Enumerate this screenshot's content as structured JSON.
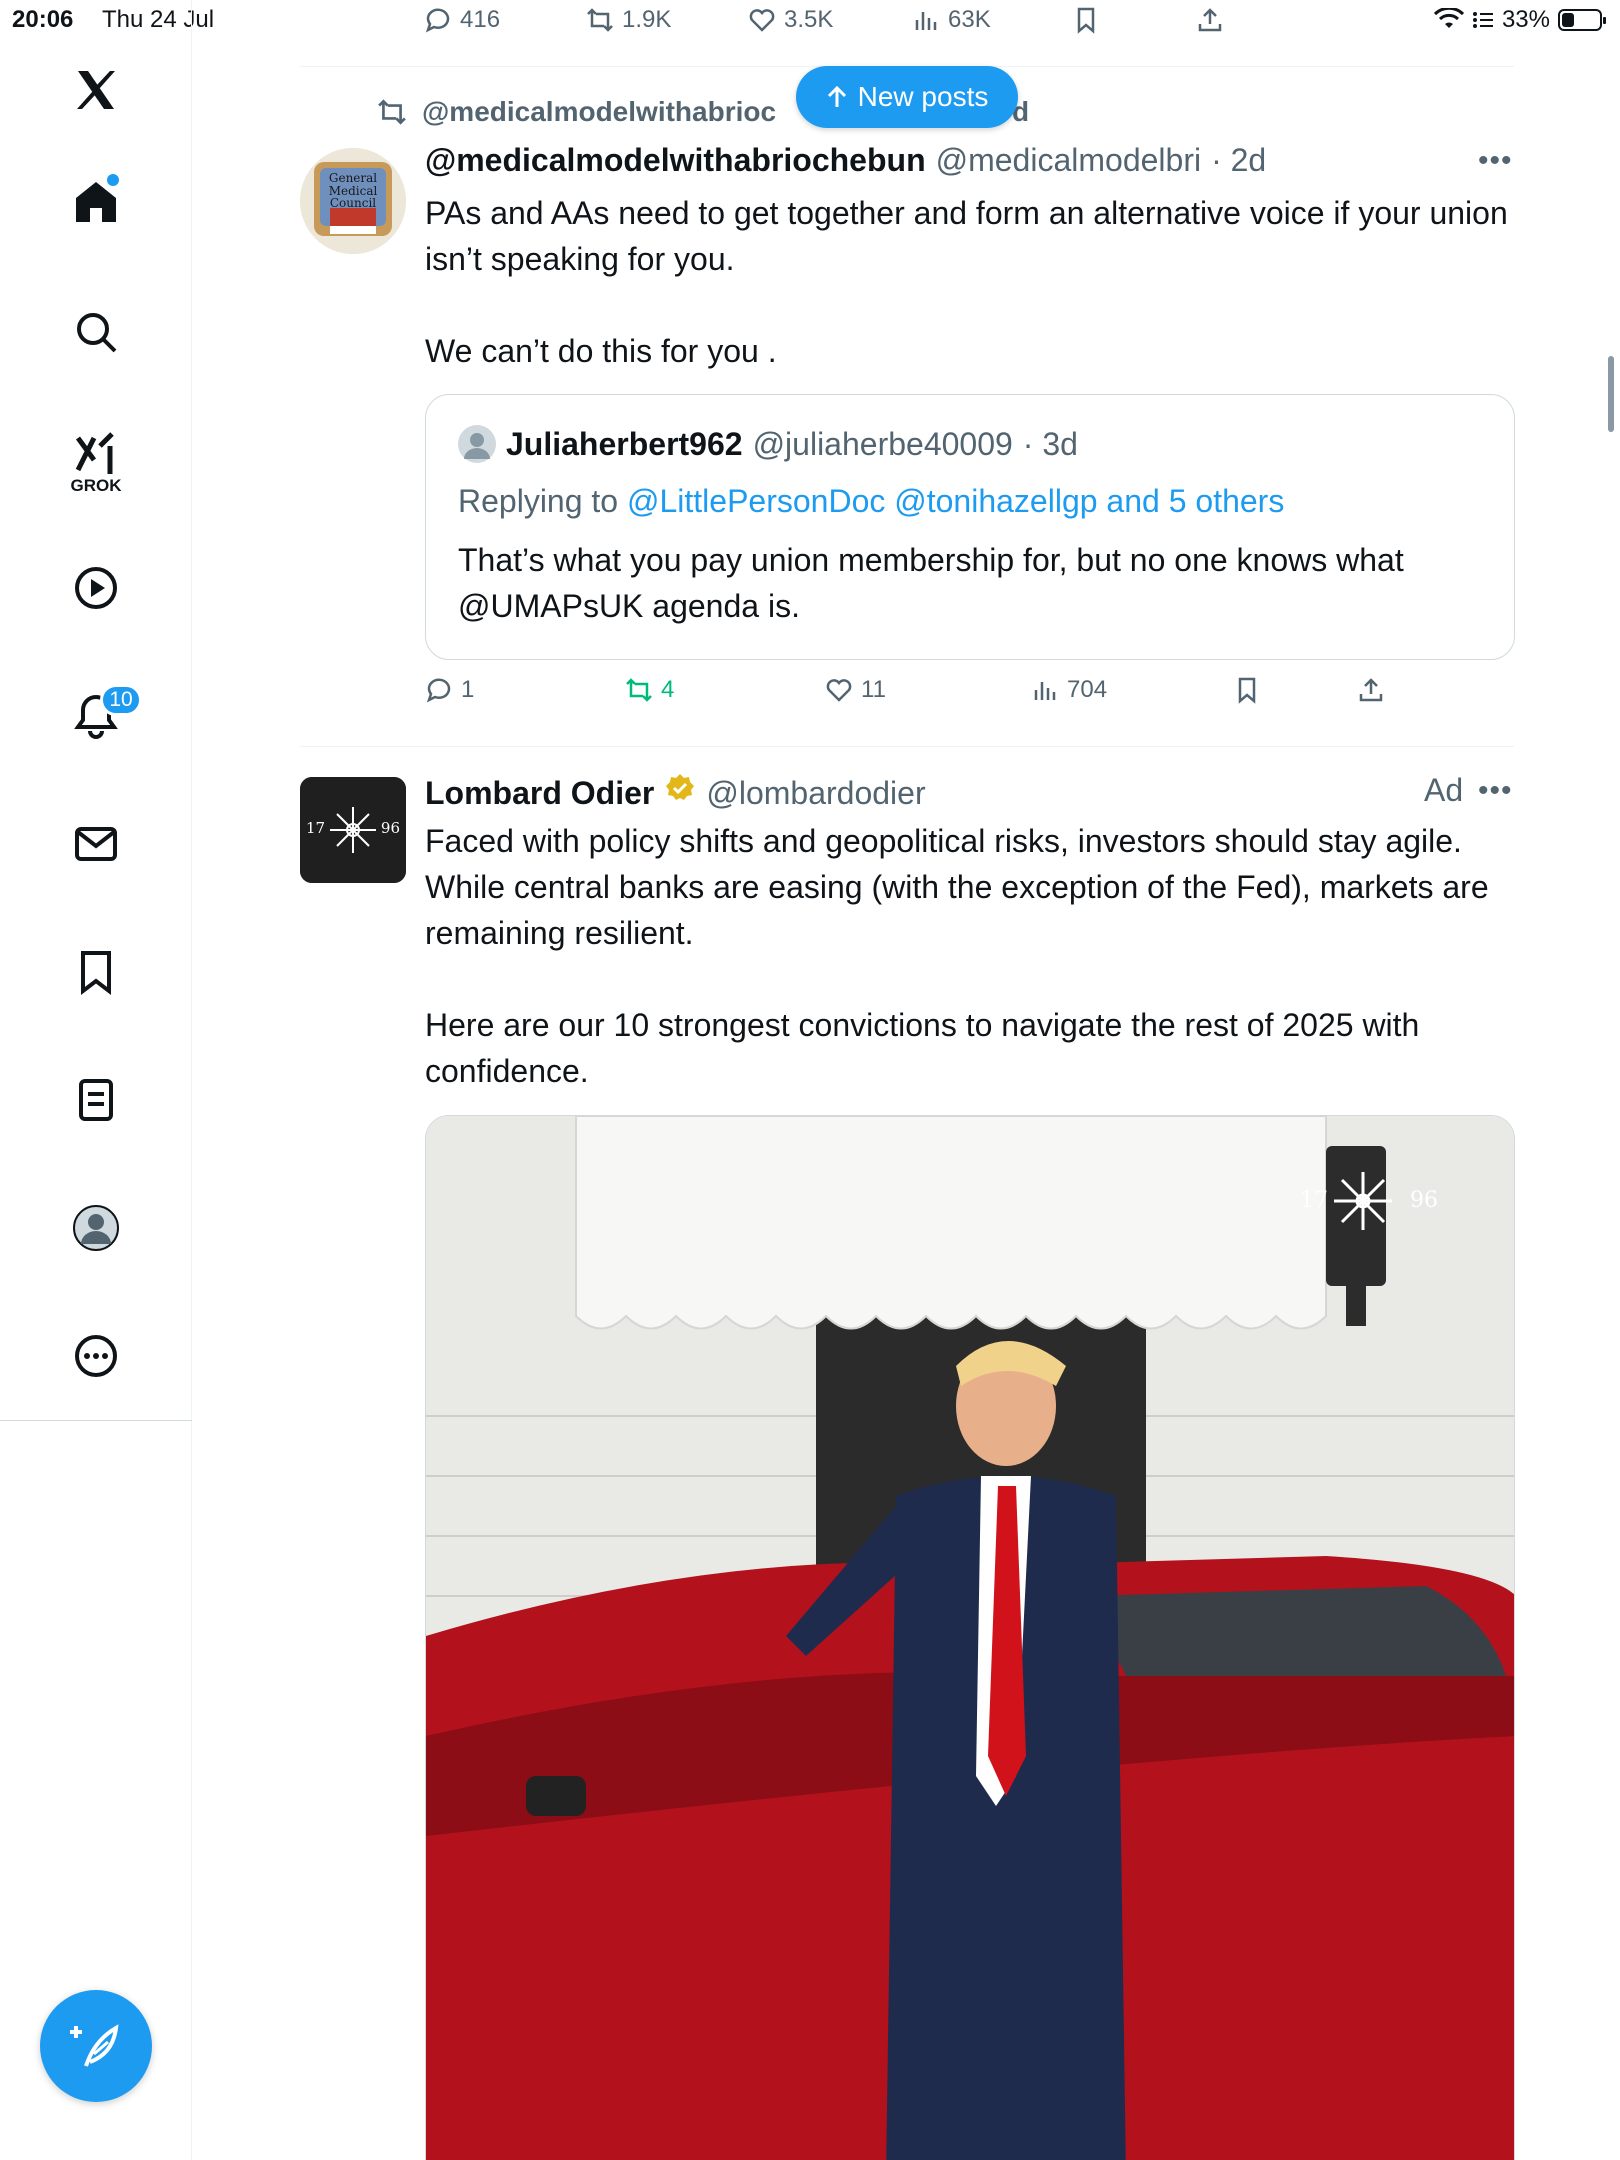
{
  "status_bar": {
    "time": "20:06",
    "date": "Thu 24 Jul",
    "battery": "33%",
    "battery_level": 0.33
  },
  "sidebar": {
    "grok_label": "GROK",
    "notifications_badge": "10"
  },
  "prev_post_actions": {
    "replies": "416",
    "reposts": "1.9K",
    "likes": "3.5K",
    "views": "63K"
  },
  "new_posts": {
    "label": "New posts"
  },
  "post1": {
    "repost_by": "@medicalmodelwithabrioc",
    "repost_suffix": "d",
    "name": "@medicalmodelwithabriochebun",
    "handle": "@medicalmodelbri",
    "time": "· 2d",
    "avatar_text": "General Medical Council",
    "text": "PAs and AAs need to get together and form an alternative voice if your union isn’t speaking for you.\n\nWe can’t do this for you .",
    "quote": {
      "name": "Juliaherbert962",
      "handle": "@juliaherbe40009",
      "time": "· 3d",
      "replying_prefix": "Replying to",
      "replying_links": "@LittlePersonDoc @tonihazellgp and 5 others",
      "text": "That’s what you pay union membership for, but no one knows what @UMAPsUK agenda is."
    },
    "actions": {
      "replies": "1",
      "reposts": "4",
      "likes": "11",
      "views": "704"
    }
  },
  "ad_post": {
    "name": "Lombard Odier",
    "handle": "@lombardodier",
    "ad_label": "Ad",
    "logo_left": "17",
    "logo_right": "96",
    "text": "Faced with policy shifts and geopolitical risks, investors should stay agile. While central banks are easing (with the exception of the Fed), markets are remaining resilient.\n\nHere are our 10 strongest convictions to navigate the rest of 2025 with confidence.",
    "media_logo_left": "17",
    "media_logo_right": "96"
  },
  "colors": {
    "accent": "#1d9bf0",
    "repost_green": "#00ba7c",
    "muted": "#536471",
    "verified_gold": "#e2b719"
  }
}
